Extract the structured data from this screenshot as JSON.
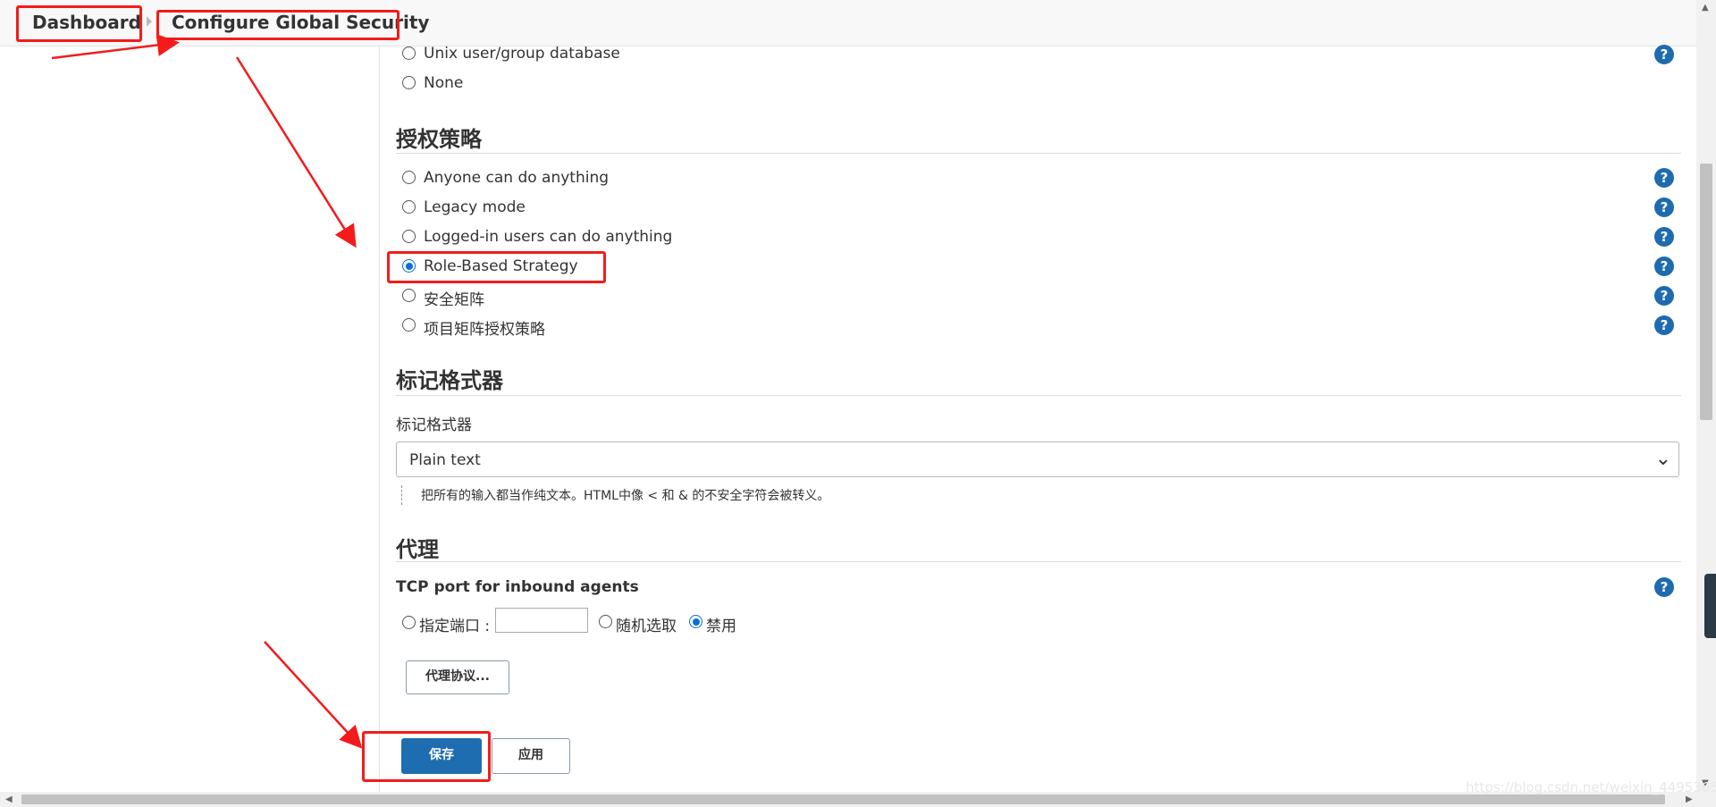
{
  "breadcrumb": {
    "home": "Dashboard",
    "current": "Configure Global Security"
  },
  "security_realm": {
    "options": [
      {
        "label": "Unix user/group database",
        "selected": false
      },
      {
        "label": "None",
        "selected": false
      }
    ]
  },
  "authorization": {
    "title": "授权策略",
    "options": [
      {
        "label": "Anyone can do anything",
        "selected": false
      },
      {
        "label": "Legacy mode",
        "selected": false
      },
      {
        "label": "Logged-in users can do anything",
        "selected": false
      },
      {
        "label": "Role-Based Strategy",
        "selected": true
      },
      {
        "label": "安全矩阵",
        "selected": false
      },
      {
        "label": "项目矩阵授权策略",
        "selected": false
      }
    ]
  },
  "markup_formatter": {
    "title": "标记格式器",
    "field_label": "标记格式器",
    "selected_value": "Plain text",
    "description": "把所有的输入都当作纯文本。HTML中像 < 和 & 的不安全字符会被转义。"
  },
  "agents": {
    "title": "代理",
    "tcp_label": "TCP port for inbound agents",
    "port_options": [
      {
        "label": "指定端口 :",
        "selected": false
      },
      {
        "label": "随机选取",
        "selected": false
      },
      {
        "label": "禁用",
        "selected": true
      }
    ],
    "port_value": "",
    "protocols_button": "代理协议..."
  },
  "buttons": {
    "save": "保存",
    "apply": "应用"
  },
  "help_icon": "?",
  "icons": {
    "help": "question-circle-icon",
    "select": "chevron-down-icon"
  },
  "colors": {
    "accent": "#1f6db1",
    "annotation": "#f31b1b"
  },
  "watermark": "https://blog.csdn.net/weixin_44953658"
}
